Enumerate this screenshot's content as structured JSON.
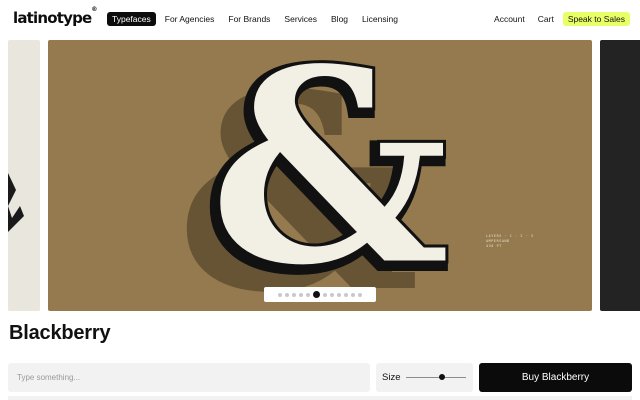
{
  "brand": {
    "logo_text": "latinotype",
    "logo_mark": "®"
  },
  "nav": {
    "items": [
      {
        "label": "Typefaces",
        "active": true
      },
      {
        "label": "For Agencies"
      },
      {
        "label": "For Brands"
      },
      {
        "label": "Services"
      },
      {
        "label": "Blog"
      },
      {
        "label": "Licensing"
      }
    ]
  },
  "account_nav": {
    "account": "Account",
    "cart": "Cart",
    "cta": "Speak to Sales",
    "cta_color": "#e8ff68"
  },
  "carousel": {
    "hero_glyph": "&",
    "hero_bg": "#947a4e",
    "credit_lines": [
      "LAYERS · 1 · 2 · 3",
      "AMPERSAND",
      "430 PT"
    ],
    "dot_count": 12,
    "active_dot": 5
  },
  "typeface": {
    "name": "Blackberry"
  },
  "tester": {
    "placeholder": "Type something...",
    "size_label": "Size",
    "size_value": 0.6
  },
  "buy_button": "Buy Blackberry"
}
